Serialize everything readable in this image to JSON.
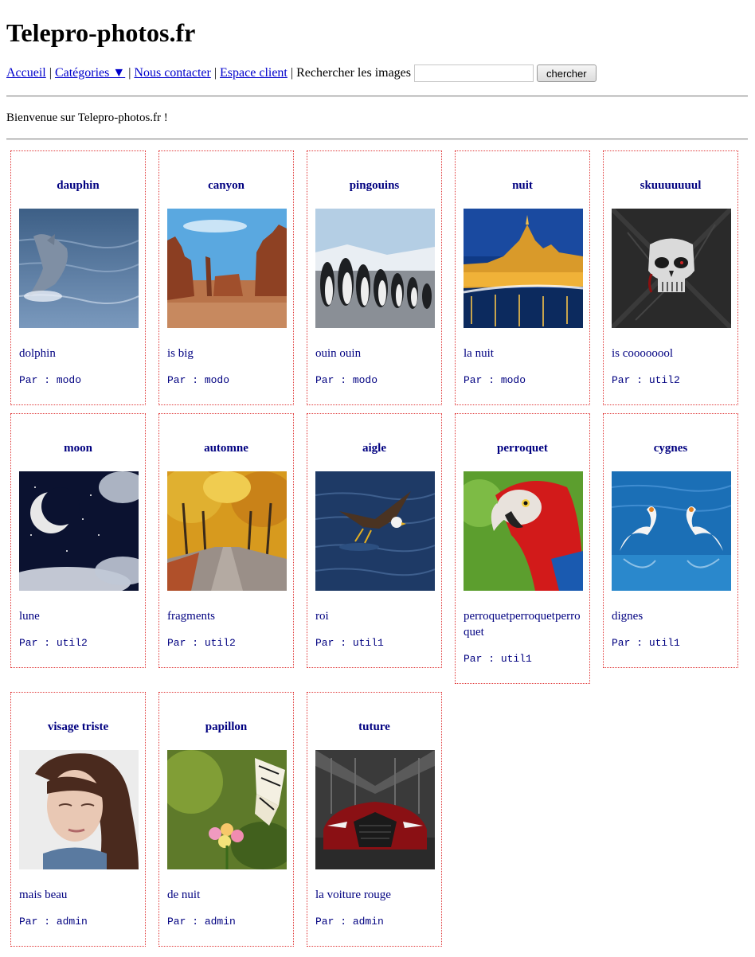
{
  "site": {
    "title": "Telepro-photos.fr"
  },
  "nav": {
    "home": "Accueil",
    "categories": "Catégories ▼",
    "contact": "Nous contacter",
    "client": "Espace client",
    "search_label": "Rechercher les images",
    "search_value": "",
    "search_button": "chercher",
    "separator": "|"
  },
  "welcome": "Bienvenue sur Telepro-photos.fr !",
  "author_prefix": "Par : ",
  "photos": [
    {
      "title": "dauphin",
      "desc": "dolphin",
      "author": "modo",
      "image": "dolphin"
    },
    {
      "title": "canyon",
      "desc": "is big",
      "author": "modo",
      "image": "canyon"
    },
    {
      "title": "pingouins",
      "desc": "ouin ouin",
      "author": "modo",
      "image": "penguins"
    },
    {
      "title": "nuit",
      "desc": "la nuit",
      "author": "modo",
      "image": "night-city"
    },
    {
      "title": "skuuuuuuul",
      "desc": "is coooooool",
      "author": "util2",
      "image": "skull"
    },
    {
      "title": "moon",
      "desc": "lune",
      "author": "util2",
      "image": "moon"
    },
    {
      "title": "automne",
      "desc": "fragments",
      "author": "util2",
      "image": "autumn-park"
    },
    {
      "title": "aigle",
      "desc": "roi",
      "author": "util1",
      "image": "eagle"
    },
    {
      "title": "perroquet",
      "desc": "perroquetperroquetperroquet",
      "author": "util1",
      "image": "parrot"
    },
    {
      "title": "cygnes",
      "desc": "dignes",
      "author": "util1",
      "image": "swans"
    },
    {
      "title": "visage triste",
      "desc": "mais beau",
      "author": "admin",
      "image": "sad-face"
    },
    {
      "title": "papillon",
      "desc": "de nuit",
      "author": "admin",
      "image": "butterfly"
    },
    {
      "title": "tuture",
      "desc": "la voiture rouge",
      "author": "admin",
      "image": "red-car"
    }
  ]
}
